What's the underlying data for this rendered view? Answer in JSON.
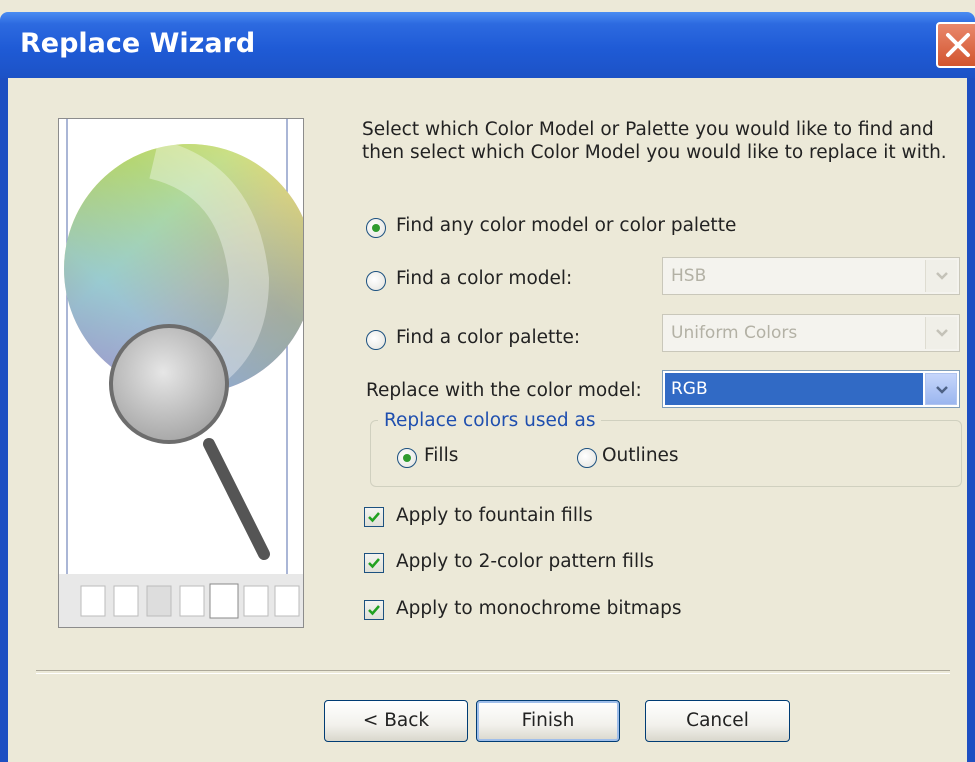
{
  "window": {
    "title": "Replace Wizard"
  },
  "instructions": "Select which Color Model or Palette you would like to find and then select which Color Model you would like to replace it with.",
  "find_options": [
    {
      "label": "Find any color model or color palette",
      "selected": true
    },
    {
      "label": "Find a color model:",
      "selected": false,
      "combo_value": "HSB"
    },
    {
      "label": "Find a color palette:",
      "selected": false,
      "combo_value": "Uniform Colors"
    }
  ],
  "replace": {
    "label": "Replace with the color model:",
    "value": "RGB"
  },
  "replace_as": {
    "title": "Replace colors used as",
    "fills_label": "Fills",
    "outlines_label": "Outlines",
    "selected": "Fills"
  },
  "checkboxes": [
    {
      "label": "Apply to fountain fills",
      "checked": true
    },
    {
      "label": "Apply to 2-color pattern fills",
      "checked": true
    },
    {
      "label": "Apply to monochrome bitmaps",
      "checked": true
    }
  ],
  "buttons": {
    "back": "< Back",
    "finish": "Finish",
    "cancel": "Cancel"
  },
  "colors": {
    "titlebar": "#1f5bd6",
    "dialog_bg": "#ece9d8",
    "selection": "#316ac5",
    "group_title": "#1f4faf"
  }
}
